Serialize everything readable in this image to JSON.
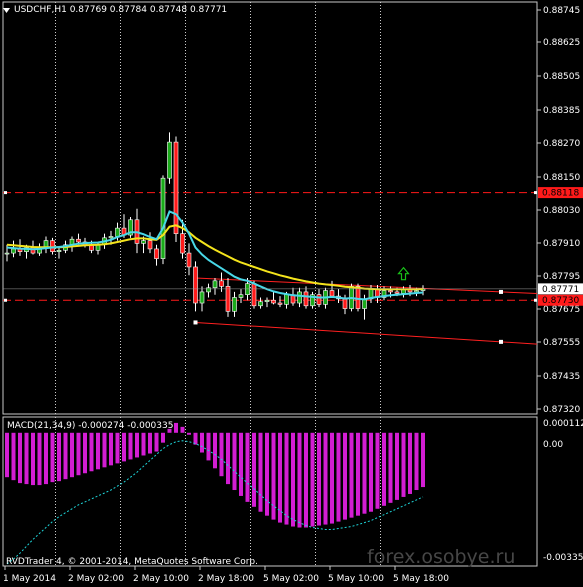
{
  "header": {
    "symbol": "USDCHF,H1",
    "ohlc": "0.87769 0.87784 0.87748 0.87771",
    "menu_icon": "triangle-down-icon"
  },
  "price_axis": {
    "ticks": [
      "0.88745",
      "0.88625",
      "0.88505",
      "0.88385",
      "0.88270",
      "0.88150",
      "0.88030",
      "0.87910",
      "0.87795",
      "0.87675",
      "0.87555",
      "0.87435",
      "0.87320"
    ],
    "current_price": "0.87771",
    "red_level_labels": [
      "0.88118",
      "0.87730"
    ]
  },
  "macd_axis": {
    "ticks": [
      "0.000112",
      "0.00",
      "-0.00335"
    ]
  },
  "macd": {
    "title": "MACD(21,34,9) -0.000274 -0.000335"
  },
  "time_axis": {
    "ticks": [
      "1 May 2014",
      "2 May 02:00",
      "2 May 10:00",
      "2 May 18:00",
      "5 May 02:00",
      "5 May 10:00",
      "5 May 18:00"
    ]
  },
  "footer": {
    "copyright": "RVDTrader 4, © 2001-2014, MetaQuotes Software Corp.",
    "watermark": "forex.osobye.ru"
  },
  "colors": {
    "background": "#000000",
    "bull": "#1aaa1a",
    "bear": "#ff1a1a",
    "ma_fast": "#48d8e8",
    "ma_slow": "#f4e41c",
    "histogram": "#d31ed3",
    "signal_line": "#1ed4d8",
    "level_line": "#ff1a1a",
    "trend_line": "#ff2020",
    "buy_arrow": "#19c119",
    "grid": "#cccccc"
  },
  "chart_data": {
    "type": "candlestick",
    "timeframe": "H1",
    "candles": [
      [
        0.87898,
        0.8793,
        0.8787,
        0.879
      ],
      [
        0.879,
        0.87945,
        0.87885,
        0.87915
      ],
      [
        0.87915,
        0.8795,
        0.8789,
        0.87905
      ],
      [
        0.87905,
        0.8793,
        0.8788,
        0.8792
      ],
      [
        0.8792,
        0.87945,
        0.87895,
        0.879
      ],
      [
        0.879,
        0.87935,
        0.8789,
        0.8792
      ],
      [
        0.8792,
        0.8796,
        0.879,
        0.87945
      ],
      [
        0.87945,
        0.87955,
        0.87895,
        0.87905
      ],
      [
        0.87905,
        0.87925,
        0.8788,
        0.8791
      ],
      [
        0.8791,
        0.87945,
        0.879,
        0.8793
      ],
      [
        0.8793,
        0.8796,
        0.87905,
        0.8795
      ],
      [
        0.8795,
        0.8797,
        0.8793,
        0.8794
      ],
      [
        0.8794,
        0.87955,
        0.8792,
        0.8793
      ],
      [
        0.8793,
        0.87945,
        0.879,
        0.8791
      ],
      [
        0.8791,
        0.8794,
        0.87895,
        0.8793
      ],
      [
        0.8793,
        0.8797,
        0.87915,
        0.87955
      ],
      [
        0.87955,
        0.8798,
        0.8793,
        0.8796
      ],
      [
        0.8796,
        0.8801,
        0.87945,
        0.8799
      ],
      [
        0.8799,
        0.8804,
        0.87955,
        0.87965
      ],
      [
        0.87965,
        0.8803,
        0.87955,
        0.8802
      ],
      [
        0.8802,
        0.8806,
        0.879,
        0.87935
      ],
      [
        0.87935,
        0.8796,
        0.879,
        0.87945
      ],
      [
        0.87945,
        0.87975,
        0.879,
        0.87915
      ],
      [
        0.87915,
        0.8793,
        0.87855,
        0.8788
      ],
      [
        0.8788,
        0.8818,
        0.8786,
        0.8817
      ],
      [
        0.8817,
        0.88335,
        0.8815,
        0.883
      ],
      [
        0.883,
        0.8832,
        0.8794,
        0.8797
      ],
      [
        0.8797,
        0.8802,
        0.8788,
        0.879
      ],
      [
        0.879,
        0.87935,
        0.8782,
        0.8785
      ],
      [
        0.8785,
        0.8787,
        0.8769,
        0.8772
      ],
      [
        0.8772,
        0.8778,
        0.8769,
        0.8776
      ],
      [
        0.8776,
        0.8779,
        0.8774,
        0.87775
      ],
      [
        0.87775,
        0.8781,
        0.8775,
        0.878
      ],
      [
        0.878,
        0.8783,
        0.8776,
        0.8778
      ],
      [
        0.8778,
        0.8781,
        0.8767,
        0.8769
      ],
      [
        0.8769,
        0.8776,
        0.8767,
        0.8774
      ],
      [
        0.8774,
        0.8777,
        0.8772,
        0.8775
      ],
      [
        0.8775,
        0.8781,
        0.8773,
        0.8779
      ],
      [
        0.8779,
        0.878,
        0.877,
        0.8771
      ],
      [
        0.8771,
        0.8774,
        0.877,
        0.87725
      ],
      [
        0.87725,
        0.8774,
        0.87705,
        0.8773
      ],
      [
        0.8773,
        0.8776,
        0.87715,
        0.8772
      ],
      [
        0.8772,
        0.87745,
        0.87705,
        0.87715
      ],
      [
        0.87715,
        0.8776,
        0.877,
        0.8775
      ],
      [
        0.8775,
        0.87775,
        0.8771,
        0.8772
      ],
      [
        0.8772,
        0.87775,
        0.87705,
        0.8776
      ],
      [
        0.8776,
        0.8778,
        0.877,
        0.8771
      ],
      [
        0.8771,
        0.8776,
        0.877,
        0.8775
      ],
      [
        0.8775,
        0.8777,
        0.87705,
        0.87715
      ],
      [
        0.87715,
        0.87775,
        0.877,
        0.87765
      ],
      [
        0.87765,
        0.878,
        0.8774,
        0.87745
      ],
      [
        0.87745,
        0.8777,
        0.8772,
        0.87735
      ],
      [
        0.87735,
        0.8775,
        0.8768,
        0.877
      ],
      [
        0.877,
        0.8779,
        0.8769,
        0.8778
      ],
      [
        0.8778,
        0.8779,
        0.8769,
        0.877
      ],
      [
        0.877,
        0.8775,
        0.8766,
        0.87735
      ],
      [
        0.87735,
        0.87785,
        0.8772,
        0.8777
      ],
      [
        0.8777,
        0.87785,
        0.8772,
        0.8774
      ],
      [
        0.8774,
        0.8778,
        0.8773,
        0.87765
      ],
      [
        0.87765,
        0.8778,
        0.8774,
        0.8776
      ],
      [
        0.8776,
        0.87775,
        0.87745,
        0.87755
      ],
      [
        0.87755,
        0.8778,
        0.8774,
        0.8777
      ],
      [
        0.8777,
        0.87785,
        0.87745,
        0.8776
      ],
      [
        0.8776,
        0.87775,
        0.87745,
        0.87765
      ],
      [
        0.87765,
        0.87784,
        0.87748,
        0.87771
      ]
    ],
    "ma_fast": [
      0.8792,
      0.87918,
      0.87916,
      0.87915,
      0.87914,
      0.87915,
      0.87918,
      0.8792,
      0.87922,
      0.87925,
      0.8793,
      0.87934,
      0.87936,
      0.87937,
      0.87938,
      0.87942,
      0.87948,
      0.87958,
      0.87965,
      0.87975,
      0.87975,
      0.87968,
      0.87958,
      0.8795,
      0.8799,
      0.8805,
      0.8804,
      0.8801,
      0.8797,
      0.8792,
      0.87895,
      0.87875,
      0.8786,
      0.87845,
      0.8783,
      0.87815,
      0.87805,
      0.878,
      0.8779,
      0.8778,
      0.8777,
      0.87762,
      0.87756,
      0.87752,
      0.87748,
      0.87746,
      0.87744,
      0.87742,
      0.8774,
      0.8774,
      0.87742,
      0.8774,
      0.87736,
      0.87738,
      0.87735,
      0.87733,
      0.87738,
      0.87742,
      0.87745,
      0.87748,
      0.8775,
      0.87752,
      0.87754,
      0.87756,
      0.87758
    ],
    "ma_slow": [
      0.8793,
      0.87928,
      0.87926,
      0.87924,
      0.87922,
      0.87921,
      0.87921,
      0.87921,
      0.87921,
      0.87922,
      0.87924,
      0.87926,
      0.87928,
      0.87929,
      0.8793,
      0.87932,
      0.87935,
      0.8794,
      0.87945,
      0.8795,
      0.87953,
      0.87953,
      0.8795,
      0.87948,
      0.87965,
      0.87995,
      0.88,
      0.8799,
      0.87975,
      0.87955,
      0.8794,
      0.87925,
      0.87912,
      0.879,
      0.87888,
      0.87876,
      0.87866,
      0.87858,
      0.8785,
      0.87842,
      0.87834,
      0.87827,
      0.8782,
      0.87814,
      0.87808,
      0.87803,
      0.87798,
      0.87794,
      0.8779,
      0.87787,
      0.87785,
      0.87782,
      0.87779,
      0.87777,
      0.87775,
      0.87772,
      0.87771,
      0.8777,
      0.8777,
      0.8777,
      0.8777,
      0.8777,
      0.8777,
      0.8777,
      0.87771
    ],
    "horizontal_levels": [
      0.88118,
      0.8773
    ],
    "trend_upper": {
      "from": [
        0.8781,
        29
      ],
      "to": [
        0.8776,
        76
      ]
    },
    "trend_lower": {
      "from": [
        0.8765,
        29
      ],
      "to": [
        0.8758,
        76
      ]
    },
    "buy_arrow_at": {
      "index": 61,
      "price": 0.87815
    },
    "yrange": [
      0.8732,
      0.88805
    ],
    "macd_histogram": [
      -0.00045,
      -0.00048,
      -0.00051,
      -0.00052,
      -0.00053,
      -0.00053,
      -0.00052,
      -0.0005,
      -0.00049,
      -0.00047,
      -0.00045,
      -0.00043,
      -0.00041,
      -0.00039,
      -0.00037,
      -0.00035,
      -0.00033,
      -0.00031,
      -0.00029,
      -0.00027,
      -0.00025,
      -0.00023,
      -0.00021,
      -0.00019,
      -0.0001,
      4e-05,
      0.0001,
      6e-05,
      -2e-05,
      -0.00012,
      -0.0002,
      -0.00028,
      -0.00036,
      -0.00044,
      -0.00052,
      -0.00058,
      -0.00064,
      -0.0007,
      -0.00075,
      -0.0008,
      -0.00084,
      -0.00088,
      -0.00091,
      -0.00093,
      -0.00095,
      -0.00096,
      -0.00096,
      -0.00095,
      -0.00094,
      -0.00093,
      -0.00092,
      -0.0009,
      -0.00088,
      -0.00086,
      -0.00084,
      -0.00082,
      -0.0008,
      -0.00077,
      -0.00074,
      -0.00071,
      -0.00068,
      -0.00065,
      -0.00062,
      -0.00058,
      -0.00055
    ],
    "macd_signal": [
      -0.00133,
      -0.00128,
      -0.00122,
      -0.00115,
      -0.00108,
      -0.00102,
      -0.00096,
      -0.0009,
      -0.00085,
      -0.00081,
      -0.00077,
      -0.00073,
      -0.0007,
      -0.00067,
      -0.00064,
      -0.00061,
      -0.00058,
      -0.00054,
      -0.0005,
      -0.00045,
      -0.0004,
      -0.00034,
      -0.00028,
      -0.00022,
      -0.00016,
      -0.00012,
      -9e-05,
      -8e-05,
      -9e-05,
      -0.00011,
      -0.00014,
      -0.00018,
      -0.00022,
      -0.00027,
      -0.00033,
      -0.00039,
      -0.00045,
      -0.00051,
      -0.00057,
      -0.00063,
      -0.00069,
      -0.00074,
      -0.00079,
      -0.00084,
      -0.00088,
      -0.00091,
      -0.00094,
      -0.00096,
      -0.00097,
      -0.00098,
      -0.00098,
      -0.00097,
      -0.00096,
      -0.00095,
      -0.00093,
      -0.00091,
      -0.00089,
      -0.00086,
      -0.00083,
      -0.0008,
      -0.00077,
      -0.00074,
      -0.00071,
      -0.00068,
      -0.00065
    ],
    "macd_range": [
      -0.00135,
      0.00016
    ],
    "time_tick_indices": [
      0,
      10,
      20,
      30,
      40,
      50,
      60
    ],
    "vertical_grid_indices": [
      7,
      17,
      27,
      37,
      47,
      57
    ],
    "xlabel": "",
    "ylabel": ""
  }
}
